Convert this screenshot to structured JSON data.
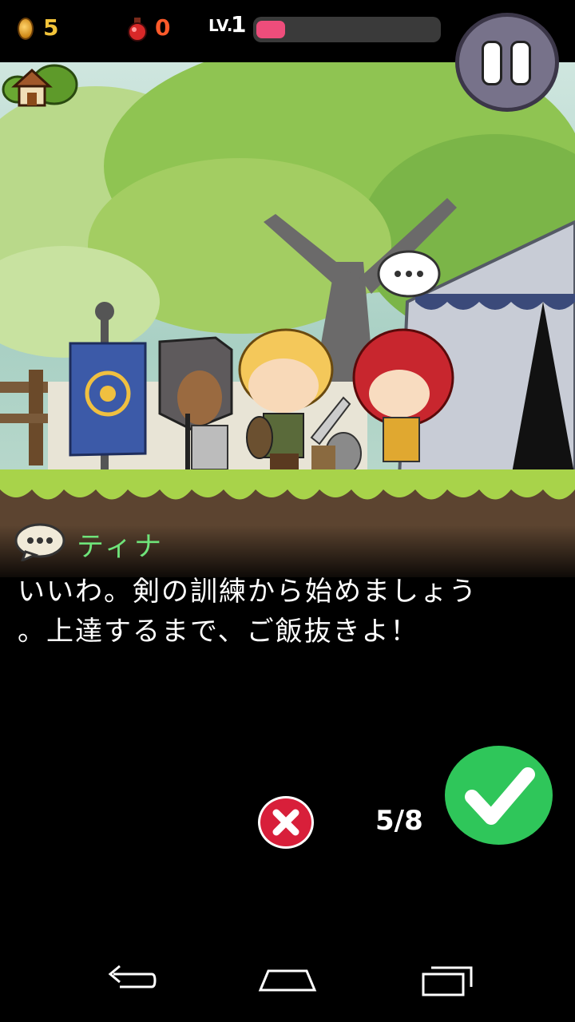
{
  "hud": {
    "coins": "5",
    "potions": "0",
    "level_label": "LV.",
    "level": "1",
    "xp_progress": 0.16
  },
  "dialogue": {
    "speaker": "ティナ",
    "lines": [
      "いいわ。剣の訓練から始めましょう",
      "。上達するまで、ご飯抜きよ！"
    ],
    "page": "5/8"
  },
  "colors": {
    "coin_text": "#f3c43a",
    "potion_text": "#ff5a2a",
    "xp_fill": "#ee4d7b",
    "speaker_name": "#6fe47a",
    "confirm": "#2fc65a",
    "cancel": "#d81f3a"
  },
  "icons": [
    "coin-icon",
    "potion-icon",
    "pause-icon",
    "home-icon",
    "speech-bubble-icon",
    "close-icon",
    "check-icon",
    "back-icon",
    "home-nav-icon",
    "recents-icon"
  ]
}
